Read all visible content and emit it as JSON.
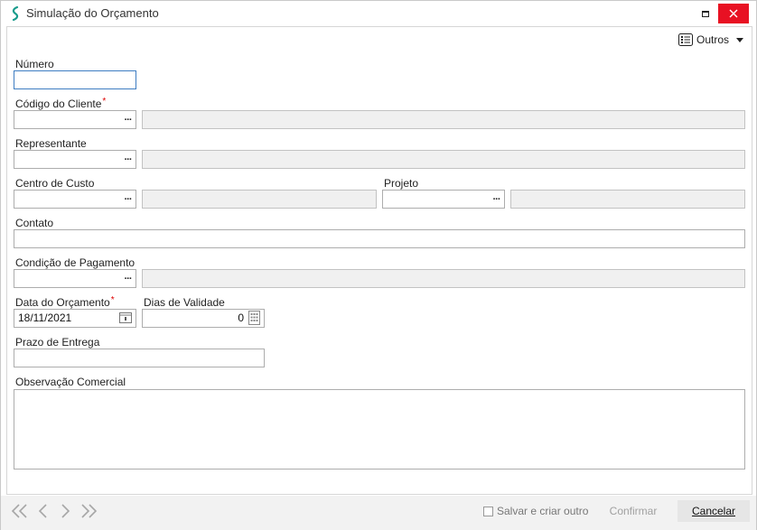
{
  "window": {
    "title": "Simulação do Orçamento"
  },
  "toolbar": {
    "others_label": "Outros"
  },
  "fields": {
    "numero": {
      "label": "Número",
      "value": ""
    },
    "codigo_cliente": {
      "label": "Código do Cliente",
      "required_mark": "*",
      "value": "",
      "description": ""
    },
    "representante": {
      "label": "Representante",
      "value": "",
      "description": ""
    },
    "centro_custo": {
      "label": "Centro de Custo",
      "value": "",
      "description": ""
    },
    "projeto": {
      "label": "Projeto",
      "value": "",
      "description": ""
    },
    "contato": {
      "label": "Contato",
      "value": ""
    },
    "condicao_pagamento": {
      "label": "Condição de Pagamento",
      "value": "",
      "description": ""
    },
    "data_orcamento": {
      "label": "Data do Orçamento",
      "required_mark": "*",
      "value": "18/11/2021"
    },
    "dias_validade": {
      "label": "Dias de Validade",
      "value": "0"
    },
    "prazo_entrega": {
      "label": "Prazo de Entrega",
      "value": ""
    },
    "observacao": {
      "label": "Observação Comercial",
      "value": ""
    }
  },
  "lookup": {
    "symbol": "···"
  },
  "footer": {
    "save_and_new_label": "Salvar e criar outro",
    "save_and_new_checked": false,
    "confirm_label": "Confirmar",
    "cancel_label": "Cancelar"
  },
  "colors": {
    "close_button": "#e81123",
    "accent_focus": "#3e7dc2",
    "logo": "#1a9c8c"
  }
}
